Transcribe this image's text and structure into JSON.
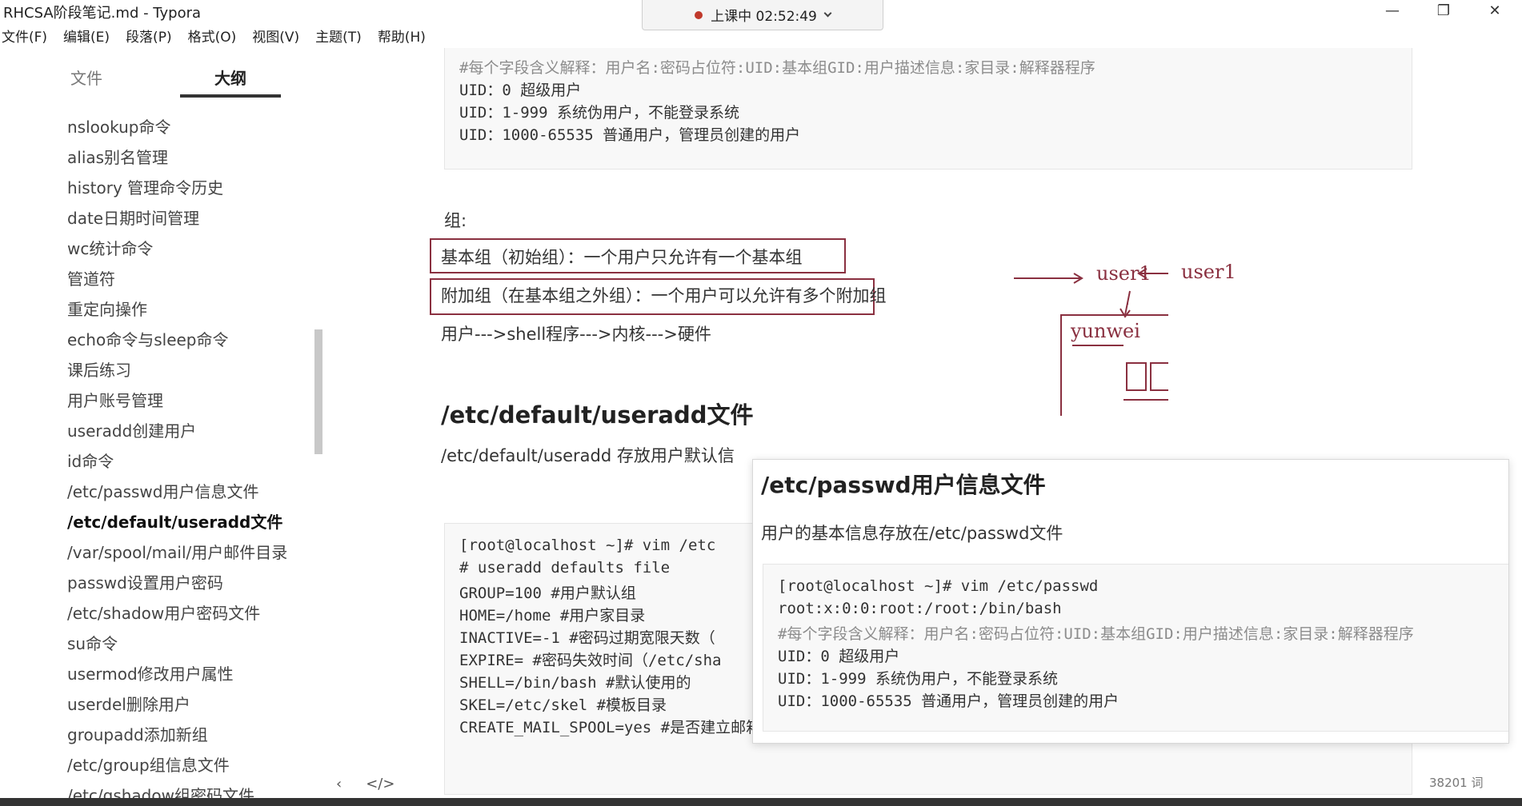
{
  "window": {
    "title": "RHCSA阶段笔记.md - Typora",
    "minimize": "—",
    "maximize": "❐",
    "close": "✕"
  },
  "recording": {
    "label": "上课中 02:52:49"
  },
  "menu": [
    "文件(F)",
    "编辑(E)",
    "段落(P)",
    "格式(O)",
    "视图(V)",
    "主题(T)",
    "帮助(H)"
  ],
  "sidebar": {
    "tab_files": "文件",
    "tab_outline": "大纲",
    "items": [
      "nslookup命令",
      "alias别名管理",
      "history 管理命令历史",
      "date日期时间管理",
      "wc统计命令",
      "管道符",
      "重定向操作",
      "echo命令与sleep命令",
      "课后练习",
      "用户账号管理",
      "useradd创建用户",
      "id命令",
      "/etc/passwd用户信息文件",
      "/etc/default/useradd文件",
      "/var/spool/mail/用户邮件目录",
      "passwd设置用户密码",
      "/etc/shadow用户密码文件",
      "su命令",
      "usermod修改用户属性",
      "userdel删除用户",
      "groupadd添加新组",
      "/etc/group组信息文件",
      "/etc/gshadow组密码文件"
    ],
    "active_index": 13,
    "back_icon": "‹",
    "source_icon": "</>"
  },
  "editor": {
    "top_code": [
      "#每个字段含义解释：用户名:密码占位符:UID:基本组GID:用户描述信息:家目录:解释器程序",
      "UID：0 超级用户",
      "UID：1-999 系统伪用户，不能登录系统",
      "UID：1000-65535 普通用户，管理员创建的用户"
    ],
    "group_label": "组:",
    "basic_group": "基本组（初始组）：一个用户只允许有一个基本组",
    "extra_group": "附加组（在基本组之外组）：一个用户可以允许有多个附加组",
    "flow": "用户--->shell程序--->内核--->硬件",
    "heading": "/etc/default/useradd文件",
    "desc": "/etc/default/useradd 存放用户默认信",
    "bottom_code": [
      "[root@localhost ~]# vim /etc",
      "# useradd defaults file",
      "GROUP=100 #用户默认组",
      "HOME=/home #用户家目录",
      "INACTIVE=-1 #密码过期宽限天数（",
      "EXPIRE= #密码失效时间（/etc/sha",
      "SHELL=/bin/bash #默认使用的",
      "SKEL=/etc/skel #模板目录",
      "CREATE_MAIL_SPOOL=yes #是否建立邮箱"
    ]
  },
  "diagram": {
    "label_user1_a": "user1",
    "label_user1_b": "user1",
    "label_yunwei": "yunwei",
    "color": "#8a3040"
  },
  "popup": {
    "title": "/etc/passwd用户信息文件",
    "text": "用户的基本信息存放在/etc/passwd文件",
    "code": [
      "[root@localhost ~]# vim /etc/passwd",
      "root:x:0:0:root:/root:/bin/bash",
      "#每个字段含义解释：用户名:密码占位符:UID:基本组GID:用户描述信息:家目录:解释器程序",
      "UID：0 超级用户",
      "UID：1-999 系统伪用户，不能登录系统",
      "UID：1000-65535 普通用户，管理员创建的用户"
    ]
  },
  "status": {
    "word_count": "38201 词"
  }
}
